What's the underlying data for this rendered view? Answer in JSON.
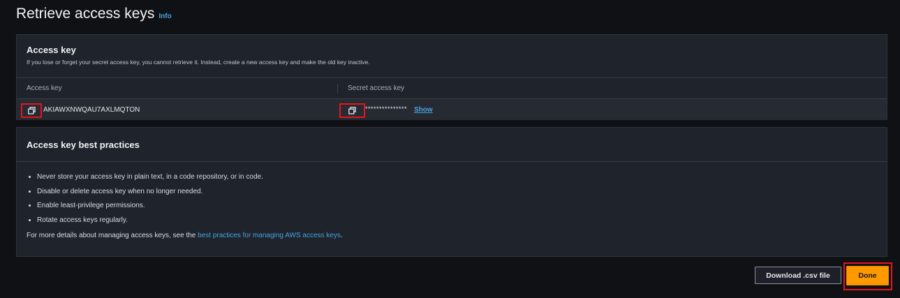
{
  "header": {
    "title": "Retrieve access keys",
    "info_link": "Info"
  },
  "access_key_panel": {
    "title": "Access key",
    "description": "If you lose or forget your secret access key, you cannot retrieve it. Instead, create a new access key and make the old key inactive.",
    "columns": [
      "Access key",
      "Secret access key"
    ],
    "access_key_value": "AKIAWXNWQAU7AXLMQTON",
    "secret_masked": "***************",
    "show_label": "Show",
    "icons": {
      "copy_access_key": "copy-icon",
      "copy_secret": "copy-icon"
    }
  },
  "best_practices_panel": {
    "title": "Access key best practices",
    "items": [
      "Never store your access key in plain text, in a code repository, or in code.",
      "Disable or delete access key when no longer needed.",
      "Enable least-privilege permissions.",
      "Rotate access keys regularly."
    ],
    "more_prefix": "For more details about managing access keys, see the ",
    "more_link": "best practices for managing AWS access keys",
    "more_suffix": "."
  },
  "actions": {
    "download_label": "Download .csv file",
    "done_label": "Done"
  },
  "colors": {
    "background": "#0f1115",
    "panel": "#1f232b",
    "link": "#4aa3df",
    "primary_button": "#ff9900",
    "highlight_box": "#e8141c"
  }
}
